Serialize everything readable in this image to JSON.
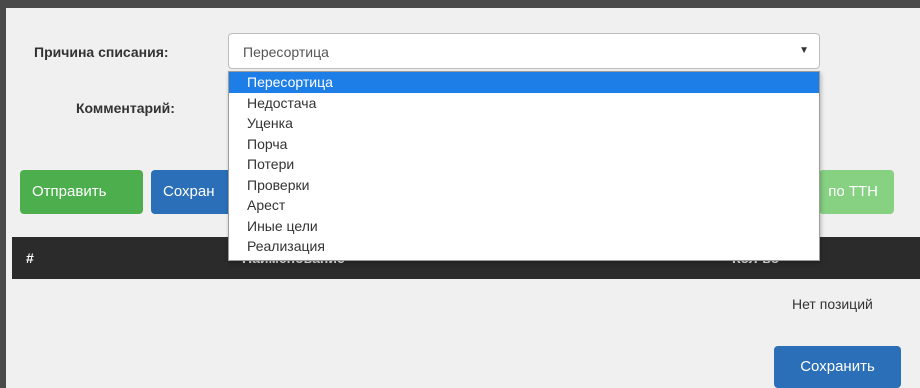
{
  "form": {
    "reason_label": "Причина списания:",
    "comment_label": "Комментарий:",
    "reason_selected": "Пересортица",
    "reason_options": [
      "Пересортица",
      "Недостача",
      "Уценка",
      "Порча",
      "Потери",
      "Проверки",
      "Арест",
      "Иные цели",
      "Реализация"
    ]
  },
  "buttons": {
    "send": "Отправить",
    "save_partial": "Сохран",
    "ttn_partial": "по ТТН",
    "save_bottom": "Сохранить"
  },
  "table": {
    "col_num": "#",
    "col_name_partial": "Наименование",
    "col_qty_partial": "Кол-во"
  },
  "empty_text": "Нет позиций",
  "colors": {
    "accent_blue": "#2a6fb7",
    "success_green": "#4cae4c",
    "option_highlight": "#1e7ee8"
  }
}
